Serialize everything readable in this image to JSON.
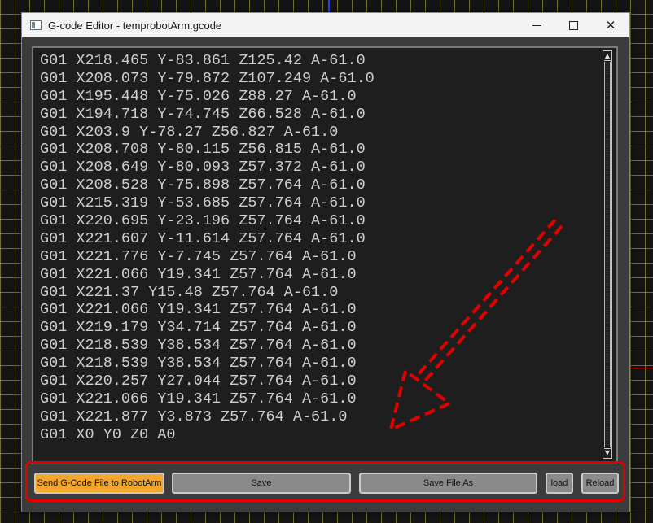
{
  "window": {
    "title": "G-code Editor - temprobotArm.gcode"
  },
  "editor": {
    "lines": [
      "G01 X218.465 Y-83.861 Z125.42 A-61.0",
      "G01 X208.073 Y-79.872 Z107.249 A-61.0",
      "G01 X195.448 Y-75.026 Z88.27 A-61.0",
      "G01 X194.718 Y-74.745 Z66.528 A-61.0",
      "G01 X203.9 Y-78.27 Z56.827 A-61.0",
      "G01 X208.708 Y-80.115 Z56.815 A-61.0",
      "G01 X208.649 Y-80.093 Z57.372 A-61.0",
      "G01 X208.528 Y-75.898 Z57.764 A-61.0",
      "G01 X215.319 Y-53.685 Z57.764 A-61.0",
      "G01 X220.695 Y-23.196 Z57.764 A-61.0",
      "G01 X221.607 Y-11.614 Z57.764 A-61.0",
      "G01 X221.776 Y-7.745 Z57.764 A-61.0",
      "G01 X221.066 Y19.341 Z57.764 A-61.0",
      "G01 X221.37 Y15.48 Z57.764 A-61.0",
      "G01 X221.066 Y19.341 Z57.764 A-61.0",
      "G01 X219.179 Y34.714 Z57.764 A-61.0",
      "G01 X218.539 Y38.534 Z57.764 A-61.0",
      "G01 X218.539 Y38.534 Z57.764 A-61.0",
      "G01 X220.257 Y27.044 Z57.764 A-61.0",
      "G01 X221.066 Y19.341 Z57.764 A-61.0",
      "G01 X221.877 Y3.873 Z57.764 A-61.0",
      "G01 X0 Y0 Z0 A0"
    ]
  },
  "buttons": {
    "send": "Send G-Code File to RobotArm",
    "save": "Save",
    "save_as": "Save File As",
    "load": "load",
    "reload": "Reload"
  },
  "colors": {
    "send_button_bg": "#f2a62e",
    "highlight_border": "#e00000",
    "editor_bg": "#1e1e1e",
    "viewport_grid": "#bebb3c"
  },
  "icons": {
    "minimize": "minimize-icon",
    "maximize": "maximize-icon",
    "close": "close-icon"
  }
}
